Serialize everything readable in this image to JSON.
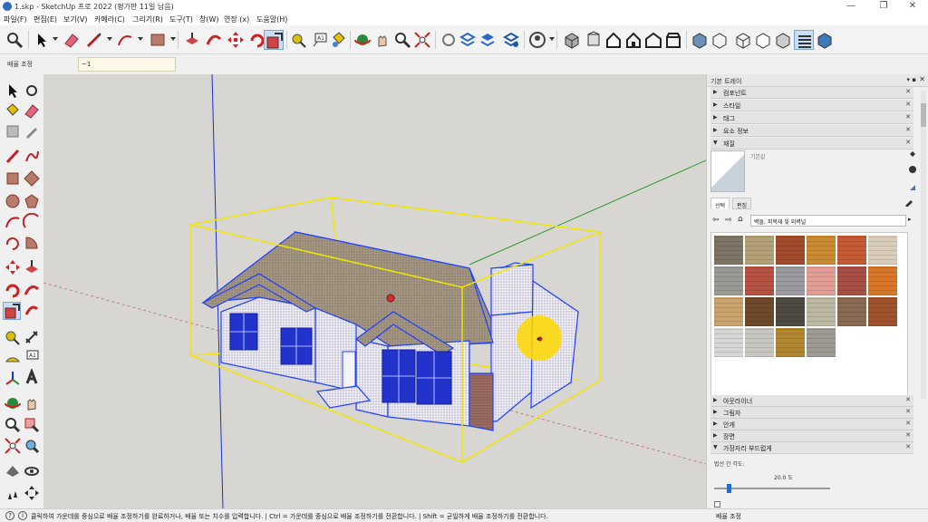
{
  "window": {
    "title": "1.skp - SketchUp 프로 2022 (평가판 11일 남음)",
    "minimize": "—",
    "maximize": "❐",
    "close": "✕"
  },
  "menu": [
    "파일(F)",
    "편집(E)",
    "보기(V)",
    "카메라(C)",
    "그리기(R)",
    "도구(T)",
    "창(W)",
    "연장 (x)",
    "도움말(H)"
  ],
  "measurements": {
    "label": "배율 조정",
    "value": "~1"
  },
  "tray": {
    "title": "기본 트레이",
    "pin": "▾ ▪",
    "close": "✕",
    "panels": [
      {
        "label": "컴포넌트",
        "expanded": false
      },
      {
        "label": "스타일",
        "expanded": false
      },
      {
        "label": "태그",
        "expanded": false
      },
      {
        "label": "요소 정보",
        "expanded": false
      },
      {
        "label": "재질",
        "expanded": true
      }
    ],
    "lower_panels": [
      {
        "label": "아웃라이너",
        "expanded": false
      },
      {
        "label": "그림자",
        "expanded": false
      },
      {
        "label": "안개",
        "expanded": false
      },
      {
        "label": "장면",
        "expanded": false
      },
      {
        "label": "가장자리 부드럽게",
        "expanded": true
      }
    ],
    "materials": {
      "name_placeholder": "기본값",
      "tabs": [
        "선택",
        "편집"
      ],
      "library": "벽돌, 피복재 및 외벽널"
    },
    "softening": {
      "label": "법선 간 각도:",
      "value": "20.0 도"
    }
  },
  "status": {
    "text": "클릭하여 가운데를 중심으로 배율 조정하기를 완료하거나, 배율 또는 치수를 입력합니다. | Ctrl = 가운데를 중심으로 배율 조정하기를 전환합니다. | Shift = 균일하게 배율 조정하기를 전환합니다.",
    "measurement_label": "배율 조정"
  },
  "colors": {
    "selection": "#1f3fff",
    "bounding_box": "#f2e600",
    "axis_red": "#b03a3a",
    "axis_green": "#2e9a2e",
    "axis_blue": "#1a2fd0",
    "highlight": "#ffd800"
  },
  "swatch_colors": [
    "#7d7466",
    "#b3a176",
    "#a24a2c",
    "#c98a32",
    "#c65a35",
    "#d9cdb9",
    "#9a9a94",
    "#b65242",
    "#9a9aa0",
    "#e29d94",
    "#a84e44",
    "#d8762a",
    "#c9a26c",
    "#6e4a2a",
    "#4e4a42",
    "#bdb8a4",
    "#8a6a52",
    "#a0522d",
    "#d6d6d4",
    "#c8c6c0",
    "#b0862e",
    "#9e9a94"
  ]
}
